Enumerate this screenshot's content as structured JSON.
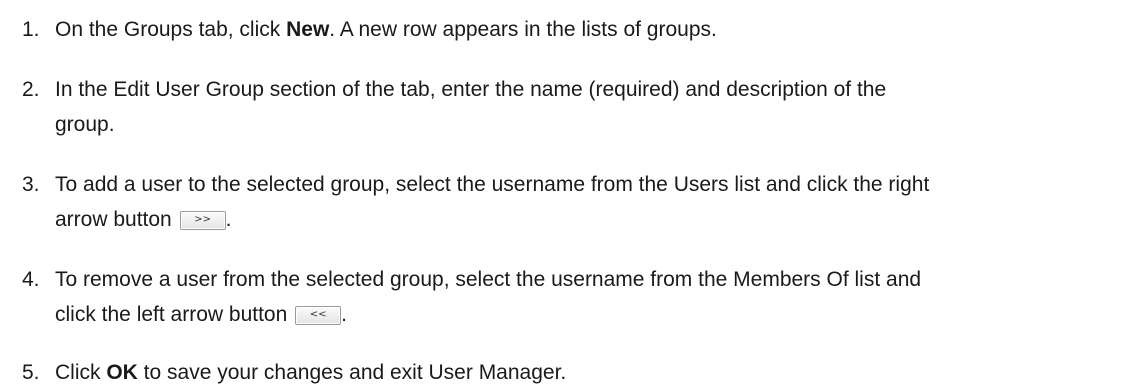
{
  "steps": [
    {
      "number": "1.",
      "pre": "On the Groups tab, click ",
      "bold": "New",
      "post": ". A new row appears in the lists of groups."
    },
    {
      "number": "2.",
      "line1": "In the Edit User Group section of the tab, enter the name (required) and description of the",
      "line2": "group."
    },
    {
      "number": "3.",
      "line1": "To add a user to the selected group, select the username from the Users list and click the right",
      "line2_pre": "arrow button ",
      "button": ">>",
      "line2_post": "."
    },
    {
      "number": "4.",
      "line1": "To remove a user from the selected group, select the username from the Members Of list and",
      "line2_pre": "click the left arrow button ",
      "button": "<<",
      "line2_post": "."
    },
    {
      "number": "5.",
      "pre": "Click ",
      "bold": "OK",
      "post": " to save your changes and exit User Manager."
    }
  ]
}
